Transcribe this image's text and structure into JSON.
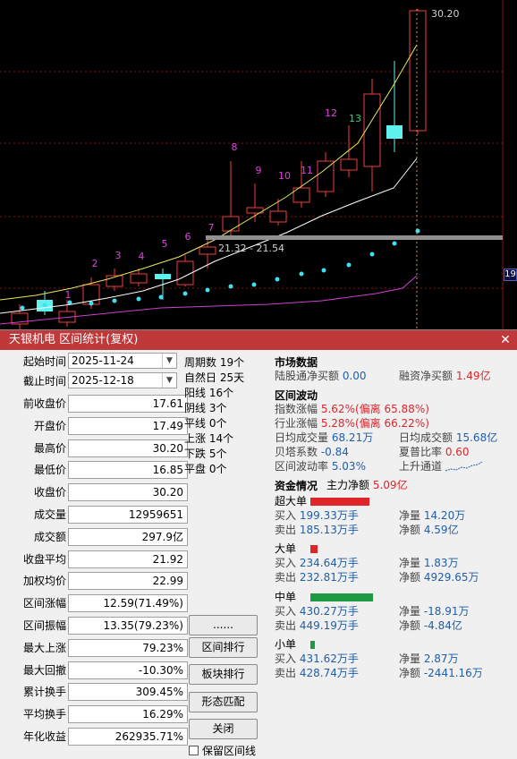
{
  "chart": {
    "price_label_top": "30.20",
    "range_label": "21.32 - 21.54",
    "axis_tag": "19",
    "counter_labels": [
      "1",
      "2",
      "3",
      "4",
      "5",
      "6",
      "7",
      "8",
      "9",
      "10",
      "11",
      "12",
      "13"
    ]
  },
  "dialog": {
    "title": "天银机电 区间统计(复权)",
    "close_glyph": "✕",
    "start_label": "起始时间",
    "start_value": "2025-11-24",
    "end_label": "截止时间",
    "end_value": "2025-12-18",
    "fields": [
      {
        "label": "前收盘价",
        "value": "17.61"
      },
      {
        "label": "开盘价",
        "value": "17.49"
      },
      {
        "label": "最高价",
        "value": "30.20"
      },
      {
        "label": "最低价",
        "value": "16.85"
      },
      {
        "label": "收盘价",
        "value": "30.20"
      },
      {
        "label": "成交量",
        "value": "12959651"
      },
      {
        "label": "成交额",
        "value": "297.9亿"
      },
      {
        "label": "收盘平均",
        "value": "21.92"
      },
      {
        "label": "加权均价",
        "value": "22.99"
      },
      {
        "label": "区间涨幅",
        "value": "12.59(71.49%)"
      },
      {
        "label": "区间振幅",
        "value": "13.35(79.23%)"
      },
      {
        "label": "最大上涨",
        "value": "79.23%"
      },
      {
        "label": "最大回撤",
        "value": "-10.30%"
      },
      {
        "label": "累计换手",
        "value": "309.45%"
      },
      {
        "label": "平均换手",
        "value": "16.29%"
      },
      {
        "label": "年化收益",
        "value": "262935.71%"
      }
    ],
    "stats": [
      "周期数 19个",
      "自然日 25天",
      "阳线 16个",
      "阴线 3个",
      "平线 0个",
      "上涨 14个",
      "下跌 5个",
      "平盘 0个"
    ],
    "buttons": [
      "......",
      "区间排行",
      "板块排行",
      "形态匹配",
      "关闭"
    ],
    "checkbox_label": "保留区间线",
    "market": {
      "title": "市场数据",
      "hk_label": "陆股通净买额",
      "hk_value": "0.00",
      "margin_label": "融资净买额",
      "margin_value": "1.49亿"
    },
    "volatility": {
      "title": "区间波动",
      "index_label": "指数涨幅",
      "index_value": "5.62%",
      "index_dev": "(偏离 65.88%)",
      "industry_label": "行业涨幅",
      "industry_value": "5.28%",
      "industry_dev": "(偏离 66.22%)",
      "daily_vol_label": "日均成交量",
      "daily_vol_value": "68.21万",
      "daily_amt_label": "日均成交额",
      "daily_amt_value": "15.68亿",
      "beta_label": "贝塔系数",
      "beta_value": "-0.84",
      "sharpe_label": "夏普比率",
      "sharpe_value": "0.60",
      "volrate_label": "区间波动率",
      "volrate_value": "5.03%",
      "channel_label": "上升通道"
    },
    "capital": {
      "title": "资金情况",
      "main_label": "主力净额",
      "main_value": "5.09亿",
      "groups": [
        {
          "name": "超大单",
          "color": "#e0252a",
          "buy_label": "买入",
          "buy": "199.33万手",
          "sell_label": "卖出",
          "sell": "185.13万手",
          "netq_label": "净量",
          "netq": "14.20万",
          "neta_label": "净额",
          "neta": "4.59亿"
        },
        {
          "name": "大单",
          "color": "#e0252a",
          "buy_label": "买入",
          "buy": "234.64万手",
          "sell_label": "卖出",
          "sell": "232.81万手",
          "netq_label": "净量",
          "netq": "1.83万",
          "neta_label": "净额",
          "neta": "4929.65万"
        },
        {
          "name": "中单",
          "color": "#1e9a45",
          "buy_label": "买入",
          "buy": "430.27万手",
          "sell_label": "卖出",
          "sell": "449.19万手",
          "netq_label": "净量",
          "netq": "-18.91万",
          "neta_label": "净额",
          "neta": "-4.84亿"
        },
        {
          "name": "小单",
          "color": "#1e9a45",
          "buy_label": "买入",
          "buy": "431.62万手",
          "sell_label": "卖出",
          "sell": "428.74万手",
          "netq_label": "净量",
          "netq": "2.87万",
          "neta_label": "净额",
          "neta": "-2441.16万"
        }
      ]
    }
  }
}
